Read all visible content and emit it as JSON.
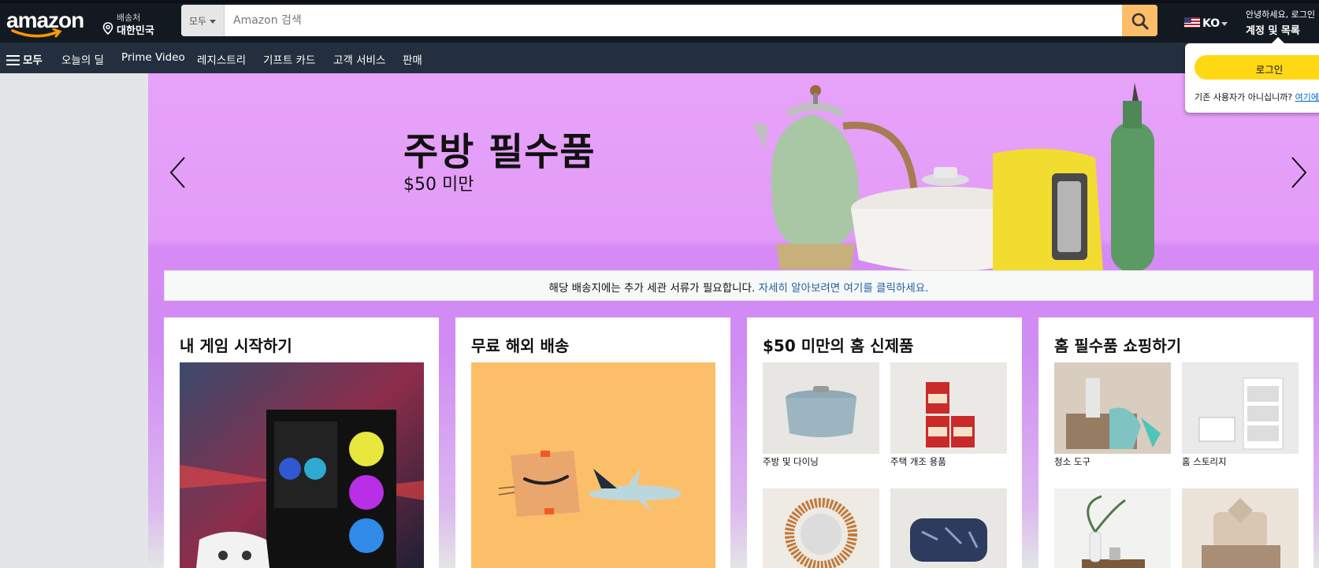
{
  "header": {
    "logo_text": "amazon",
    "deliver_line1": "배송처",
    "deliver_line2": "대한민국",
    "search_category": "모두",
    "search_placeholder": "Amazon 검색",
    "language": "KO",
    "account_line1": "안녕하세요, 로그인",
    "account_line2": "계정 및 목록"
  },
  "nav": {
    "all_label": "모두",
    "items": [
      "오늘의 딜",
      "Prime Video",
      "레지스트리",
      "기프트 카드",
      "고객 서비스",
      "판매"
    ]
  },
  "hero": {
    "title": "주방 필수품",
    "subtitle": "$50 미만"
  },
  "notice": {
    "text": "해당 배송지에는 추가 세관 서류가 필요합니다.",
    "link": "자세히 알아보려면 여기를 클릭하세요."
  },
  "cards": [
    {
      "title": "내 게임 시작하기"
    },
    {
      "title": "무료 해외 배송"
    },
    {
      "title": "$50 미만의 홈 신제품",
      "tiles": [
        "주방 및 다이닝",
        "주택 개조 용품",
        "",
        ""
      ]
    },
    {
      "title": "홈 필수품 쇼핑하기",
      "tiles": [
        "청소 도구",
        "홈 스토리지",
        "",
        ""
      ]
    }
  ],
  "popover": {
    "login_label": "로그인",
    "new_user_text": "기존 사용자가 아니십니까?",
    "new_user_link": "여기에서 시작합니다."
  },
  "colors": {
    "header_bg": "#131921",
    "nav_bg": "#232f3e",
    "search_button": "#febd69",
    "hero_bg": "#e29cf8",
    "login_button": "#ffd814"
  }
}
